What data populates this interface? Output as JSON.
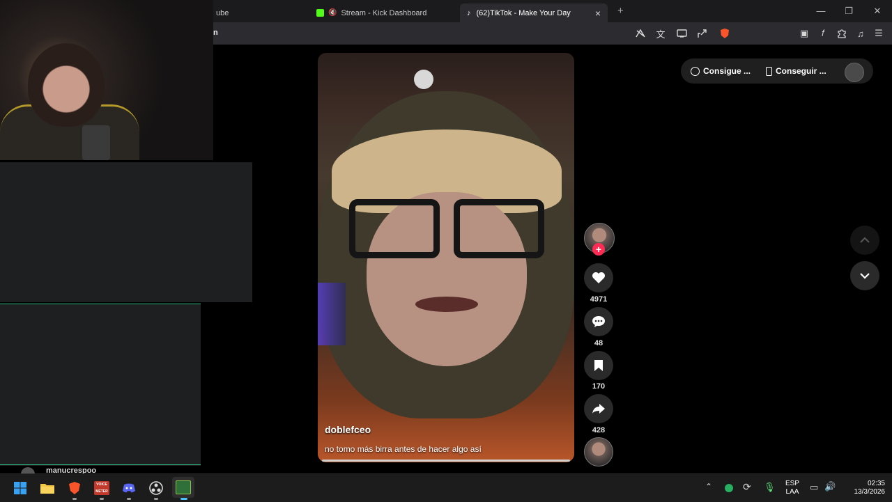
{
  "browser": {
    "tabs": [
      {
        "label": "ube",
        "active": false
      },
      {
        "label": "Stream - Kick Dashboard",
        "active": false
      },
      {
        "label": "(62)TikTok - Make Your Day",
        "active": true
      }
    ],
    "new_tab": "+",
    "address_fragment": "n",
    "close_tab": "×"
  },
  "stream_overlay": {
    "chat_username": "manucrespoo"
  },
  "video": {
    "username": "doblefceo",
    "caption": "no tomo más birra antes de hacer algo así"
  },
  "actions": {
    "likes": "4971",
    "comments": "48",
    "saves": "170",
    "shares": "428",
    "follow_plus": "+"
  },
  "top_right": {
    "coins_label": "Consigue ...",
    "app_label": "Conseguir ..."
  },
  "taskbar": {
    "language_top": "ESP",
    "language_bottom": "LAA",
    "time": "02:35",
    "date": "13/3/2026"
  },
  "colors": {
    "tiktok_red": "#fe2c55",
    "kick_green": "#53fc18",
    "overlay_green": "#2fbf85"
  }
}
